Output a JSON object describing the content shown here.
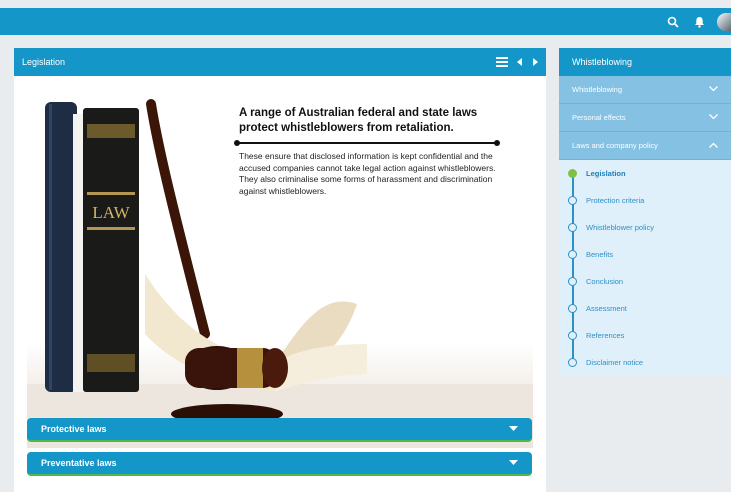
{
  "topbar": {
    "icons": [
      "search-icon",
      "bell-icon",
      "avatar"
    ]
  },
  "main": {
    "title": "Legislation",
    "controls": [
      "menu-icon",
      "prev-arrow-icon",
      "next-arrow-icon"
    ],
    "hero": {
      "heading": "A range of Australian federal and state laws protect whistleblowers from retaliation.",
      "body": "These ensure that disclosed information is kept confidential and the accused companies cannot take legal action against whistleblowers. They also criminalise some forms of harassment and discrimination against whistleblowers.",
      "book_spine_text": "LAW"
    },
    "accordions": [
      {
        "label": "Protective laws"
      },
      {
        "label": "Preventative laws"
      }
    ]
  },
  "sidebar": {
    "title": "Whistleblowing",
    "sections": [
      {
        "label": "Whistleblowing",
        "expanded": false
      },
      {
        "label": "Personal effects",
        "expanded": false
      },
      {
        "label": "Laws and company policy",
        "expanded": true
      }
    ],
    "items": [
      {
        "label": "Legislation",
        "active": true
      },
      {
        "label": "Protection criteria"
      },
      {
        "label": "Whistleblower policy"
      },
      {
        "label": "Benefits"
      },
      {
        "label": "Conclusion"
      },
      {
        "label": "Assessment"
      },
      {
        "label": "References"
      },
      {
        "label": "Disclaimer notice"
      }
    ]
  },
  "colors": {
    "primary": "#1596c8",
    "light": "#84c1e3",
    "active": "#7fc243"
  }
}
